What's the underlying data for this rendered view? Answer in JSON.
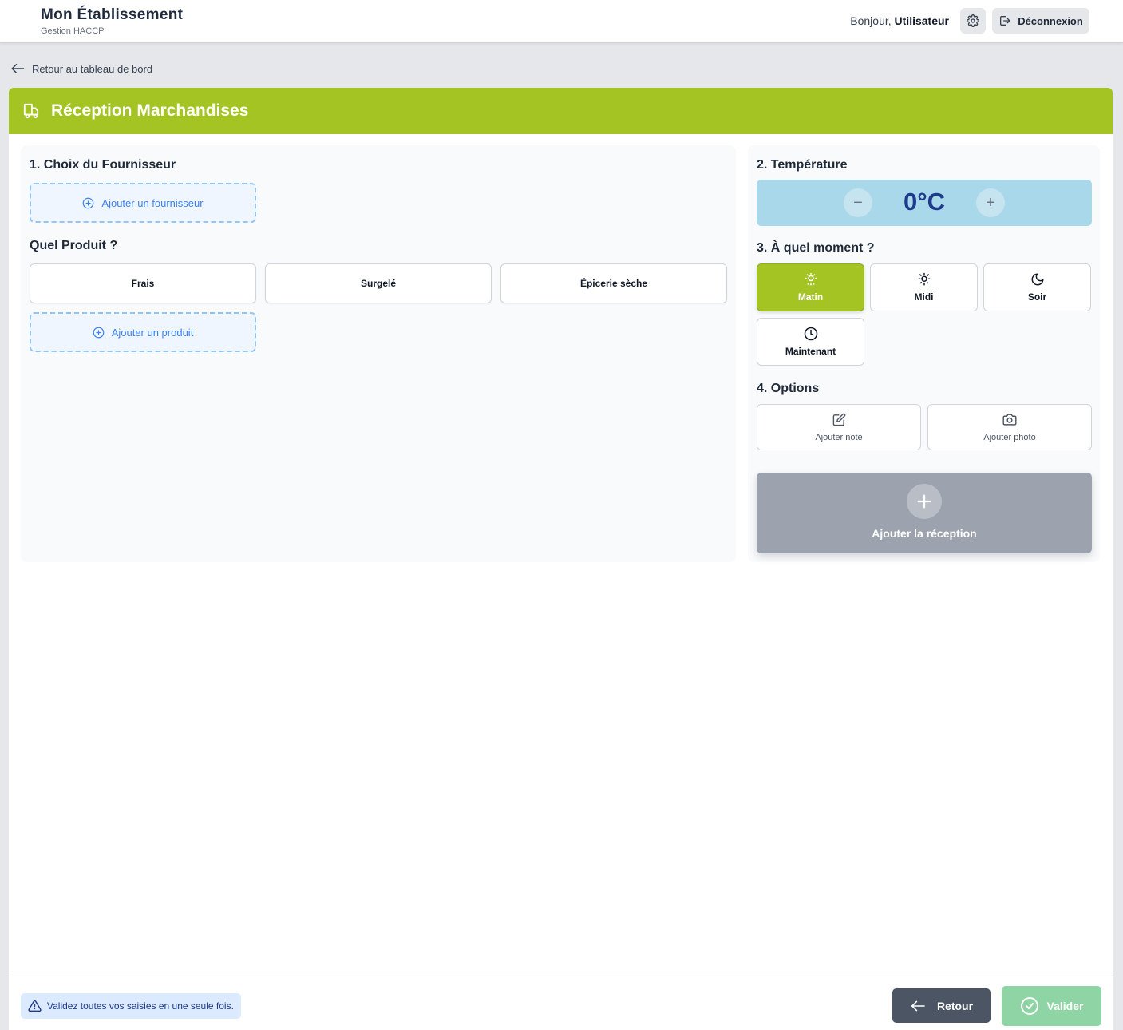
{
  "header": {
    "brand_title": "Mon Établissement",
    "brand_subtitle": "Gestion HACCP",
    "greeting_prefix": "Bonjour,",
    "user_name": "Utilisateur",
    "logout_label": "Déconnexion"
  },
  "back_link": {
    "label": "Retour au tableau de bord"
  },
  "page": {
    "title": "Réception Marchandises"
  },
  "supplier": {
    "title": "1. Choix du Fournisseur",
    "add_label": "Ajouter un fournisseur"
  },
  "product": {
    "title": "Quel Produit ?",
    "options": [
      "Frais",
      "Surgelé",
      "Épicerie sèche"
    ],
    "add_label": "Ajouter un produit"
  },
  "temperature": {
    "title": "2. Température",
    "value": "0°C",
    "decrement_symbol": "−",
    "increment_symbol": "+"
  },
  "moment": {
    "title": "3. À quel moment ?",
    "options": [
      "Matin",
      "Midi",
      "Soir",
      "Maintenant"
    ],
    "selected": "Matin"
  },
  "options": {
    "title": "4. Options",
    "note_label": "Ajouter note",
    "photo_label": "Ajouter photo"
  },
  "add_reception": {
    "label": "Ajouter la réception"
  },
  "footer": {
    "notice": "Validez toutes vos saisies en une seule fois.",
    "back_label": "Retour",
    "validate_label": "Valider"
  },
  "colors": {
    "accent_green": "#a4c424",
    "temperature_bg": "#a9d8ea",
    "temperature_text": "#1e3a8a",
    "dashed_blue": "#3b82f6",
    "validate_green": "#8ed4a4",
    "back_dark": "#4b5563",
    "add_reception_gray": "#9ca3af"
  }
}
